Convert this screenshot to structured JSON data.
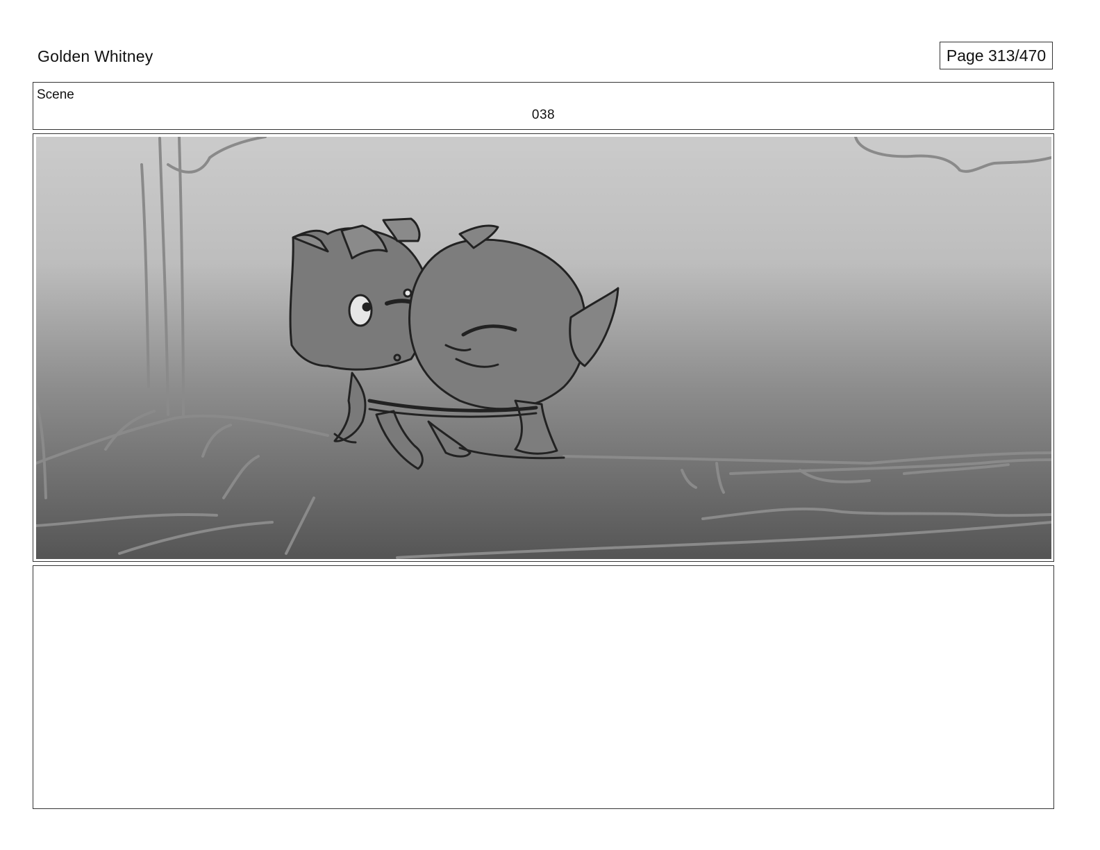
{
  "header": {
    "project_title": "Golden Whitney",
    "page_indicator": "Page 313/470"
  },
  "scene": {
    "label": "Scene",
    "number": "038"
  },
  "panel": {
    "image_subject": "storyboard-sketch-two-characters-on-log",
    "colors": {
      "sky_top": "#cbcbcb",
      "ground_bottom": "#555555",
      "line": "#222222"
    }
  },
  "notes": {
    "text": ""
  }
}
